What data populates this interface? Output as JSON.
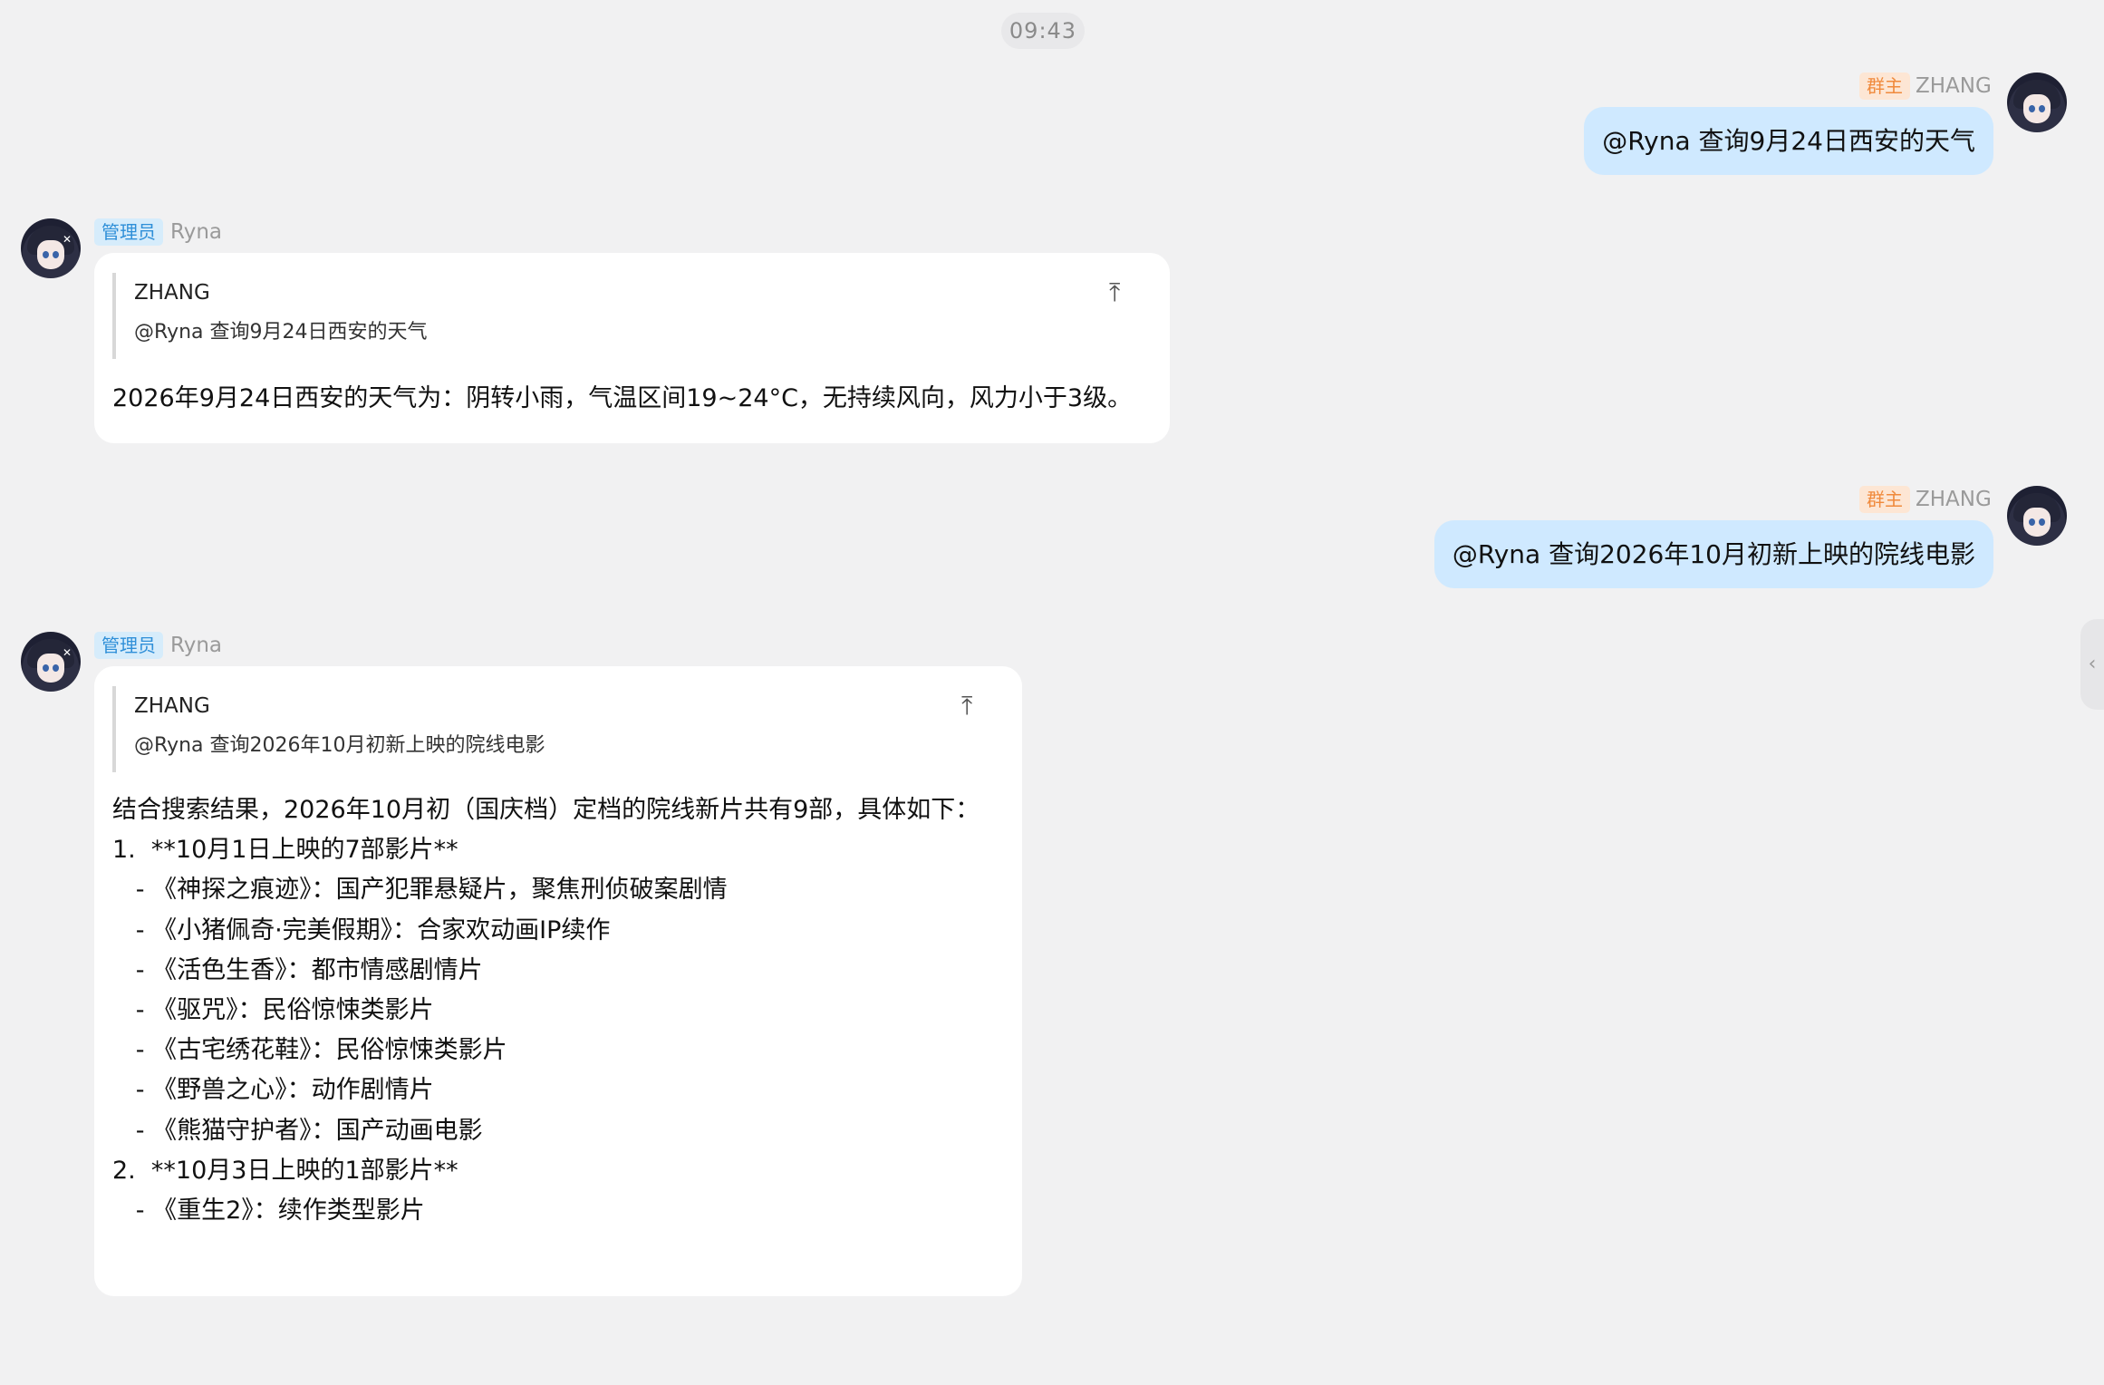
{
  "timestamp": "09:43",
  "messages": [
    {
      "sender": "ZHANG",
      "role": "群主",
      "text": "@Ryna 查询9月24日西安的天气"
    },
    {
      "sender": "Ryna",
      "role": "管理员",
      "quote": {
        "name": "ZHANG",
        "text": "@Ryna 查询9月24日西安的天气",
        "jump_icon": "⤒"
      },
      "text": "2026年9月24日西安的天气为：阴转小雨，气温区间19~24°C，无持续风向，风力小于3级。"
    },
    {
      "sender": "ZHANG",
      "role": "群主",
      "text": "@Ryna 查询2026年10月初新上映的院线电影"
    },
    {
      "sender": "Ryna",
      "role": "管理员",
      "quote": {
        "name": "ZHANG",
        "text": "@Ryna 查询2026年10月初新上映的院线电影",
        "jump_icon": "⤒"
      },
      "text": "结合搜索结果，2026年10月初（国庆档）定档的院线新片共有9部，具体如下：\n1.  **10月1日上映的7部影片**\n   - 《神探之痕迹》：国产犯罪悬疑片，聚焦刑侦破案剧情\n   - 《小猪佩奇·完美假期》：合家欢动画IP续作\n   - 《活色生香》：都市情感剧情片\n   - 《驱咒》：民俗惊悚类影片\n   - 《古宅绣花鞋》：民俗惊悚类影片\n   - 《野兽之心》：动作剧情片\n   - 《熊猫守护者》：国产动画电影\n2.  **10月3日上映的1部影片**\n   - 《重生2》：续作类型影片"
    }
  ],
  "side_panel_toggle": "‹"
}
